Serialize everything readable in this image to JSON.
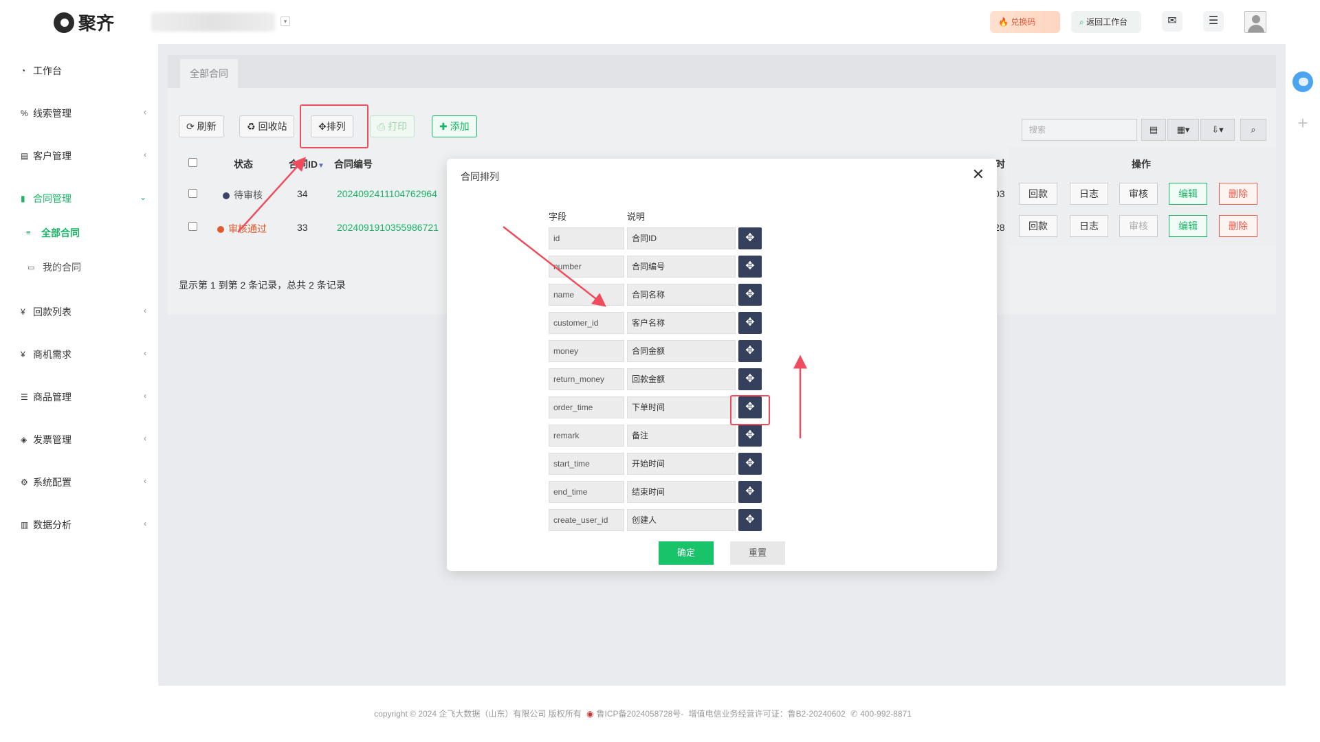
{
  "header": {
    "brand": "聚齐",
    "redeem_label": "兑换码",
    "back_label": "返回工作台"
  },
  "sidebar": {
    "items": [
      {
        "label": "工作台"
      },
      {
        "label": "线索管理"
      },
      {
        "label": "客户管理"
      },
      {
        "label": "合同管理"
      },
      {
        "label": "回款列表"
      },
      {
        "label": "商机需求"
      },
      {
        "label": "商品管理"
      },
      {
        "label": "发票管理"
      },
      {
        "label": "系统配置"
      },
      {
        "label": "数据分析"
      }
    ],
    "sub_items": [
      {
        "label": "全部合同"
      },
      {
        "label": "我的合同"
      }
    ]
  },
  "tabs": {
    "active": "全部合同"
  },
  "toolbar": {
    "refresh": "刷新",
    "recycle": "回收站",
    "sort": "排列",
    "print": "打印",
    "add": "添加",
    "search_placeholder": "搜索"
  },
  "table": {
    "headers": {
      "status": "状态",
      "id": "合同ID",
      "number": "合同编号",
      "time_frag": "时",
      "ops": "操作"
    },
    "rows": [
      {
        "status": "待审核",
        "status_color": "#3b4367",
        "id": "34",
        "number": "2024092411104762964",
        "time_frag": "03"
      },
      {
        "status": "审核通过",
        "status_color": "#e25a2b",
        "id": "33",
        "number": "2024091910355986721",
        "time_frag": "28"
      }
    ],
    "ops": {
      "return": "回款",
      "log": "日志",
      "audit": "审核",
      "edit": "编辑",
      "delete": "删除"
    },
    "summary": "显示第 1 到第 2 条记录，总共 2 条记录"
  },
  "modal": {
    "title": "合同排列",
    "col_field": "字段",
    "col_desc": "说明",
    "rows": [
      {
        "field": "id",
        "desc": "合同ID"
      },
      {
        "field": "number",
        "desc": "合同编号"
      },
      {
        "field": "name",
        "desc": "合同名称"
      },
      {
        "field": "customer_id",
        "desc": "客户名称"
      },
      {
        "field": "money",
        "desc": "合同金额"
      },
      {
        "field": "return_money",
        "desc": "回款金额"
      },
      {
        "field": "order_time",
        "desc": "下单时间"
      },
      {
        "field": "remark",
        "desc": "备注"
      },
      {
        "field": "start_time",
        "desc": "开始时间"
      },
      {
        "field": "end_time",
        "desc": "结束时间"
      },
      {
        "field": "create_user_id",
        "desc": "创建人"
      }
    ],
    "ok": "确定",
    "reset": "重置"
  },
  "footer": {
    "copyright": "copyright © 2024 企飞大数据（山东）有限公司 版权所有",
    "icp": "鲁ICP备2024058728号-",
    "license": "增值电信业务经营许可证：鲁B2-20240602",
    "phone": "400-992-8871"
  },
  "colors": {
    "accent": "#18b566",
    "annotation": "#ef4d5d",
    "move_btn": "#34405c"
  }
}
